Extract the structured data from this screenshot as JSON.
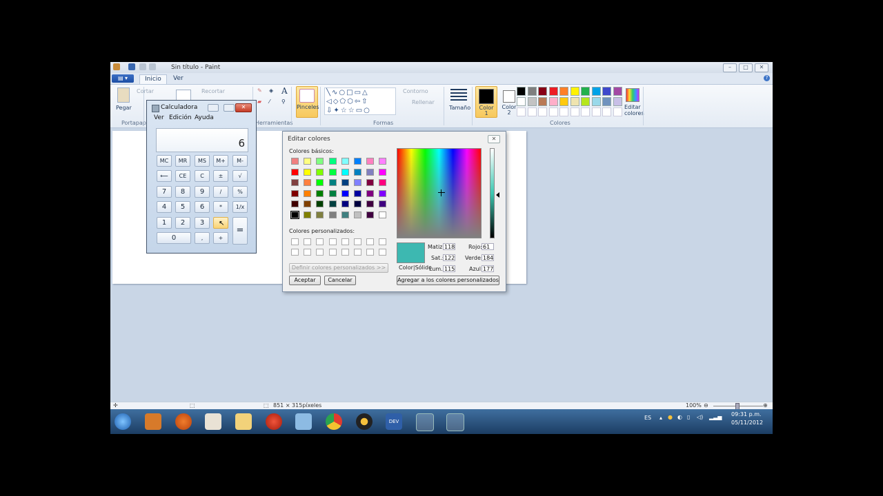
{
  "window": {
    "title": "Sin título - Paint",
    "min": "–",
    "max": "□",
    "close": "✕"
  },
  "tabs": [
    {
      "label": "Inicio"
    },
    {
      "label": "Ver"
    }
  ],
  "ribbon": {
    "paste": "Pegar",
    "cut": "Cortar",
    "crop": "Recortar",
    "clipboard_group": "Portapape",
    "tools_group": "Herramientas",
    "brushes": "Pinceles",
    "outline": "Contorno",
    "fill": "Rellenar",
    "shapes_group": "Formas",
    "size": "Tamaño",
    "color1": "Color\n1",
    "color2": "Color\n2",
    "edit_colors": "Editar\ncolores",
    "colors_group": "Colores"
  },
  "status": {
    "dimensions": "851 × 315píxeles",
    "zoom": "100%"
  },
  "taskbar": {
    "lang": "ES",
    "time": "09:31 p.m.",
    "date": "05/11/2012"
  },
  "calculator": {
    "title": "Calculadora",
    "menu": [
      "Ver",
      "Edición",
      "Ayuda"
    ],
    "display": "6",
    "keys": {
      "mc": "MC",
      "mr": "MR",
      "ms": "MS",
      "mplus": "M+",
      "mminus": "M-",
      "back": "⟵",
      "ce": "CE",
      "c": "C",
      "pm": "±",
      "sqrt": "√",
      "k7": "7",
      "k8": "8",
      "k9": "9",
      "div": "/",
      "pct": "%",
      "k4": "4",
      "k5": "5",
      "k6": "6",
      "mul": "*",
      "inv": "1/x",
      "k1": "1",
      "k2": "2",
      "k3": "3",
      "sub": "-",
      "eq": "=",
      "k0": "0",
      "dot": ",",
      "add": "+"
    }
  },
  "edit_colors": {
    "title": "Editar colores",
    "basic_label": "Colores básicos:",
    "custom_label": "Colores personalizados:",
    "define_button": "Definir colores personalizados >>",
    "ok": "Aceptar",
    "cancel": "Cancelar",
    "add_custom": "Agregar a los colores personalizados",
    "color_solid": "Color|Sólido",
    "hue_label": "Matiz:",
    "hue": "118",
    "sat_label": "Sat.:",
    "sat": "122",
    "lum_label": "Lum.:",
    "lum": "115",
    "red_label": "Rojo:",
    "red": "61",
    "green_label": "Verde:",
    "green": "184",
    "blue_label": "Azul:",
    "blue": "177",
    "preview_color": "#3db8b1",
    "basic_colors": [
      [
        "#f08080",
        "#ffff80",
        "#80ff80",
        "#00ff80",
        "#80ffff",
        "#0080ff",
        "#ff80c0",
        "#ff80ff"
      ],
      [
        "#ff0000",
        "#ffff00",
        "#80ff00",
        "#00ff40",
        "#00ffff",
        "#0080c0",
        "#8080c0",
        "#ff00ff"
      ],
      [
        "#804040",
        "#ff8040",
        "#00ff00",
        "#008080",
        "#004080",
        "#8080ff",
        "#800040",
        "#ff0080"
      ],
      [
        "#800000",
        "#ff8000",
        "#008000",
        "#008040",
        "#0000ff",
        "#0000a0",
        "#800080",
        "#8000ff"
      ],
      [
        "#400000",
        "#804000",
        "#004000",
        "#004040",
        "#000080",
        "#000040",
        "#400040",
        "#400080"
      ],
      [
        "#000000",
        "#808000",
        "#808040",
        "#808080",
        "#408080",
        "#c0c0c0",
        "#400040",
        "#ffffff"
      ]
    ]
  },
  "palette": [
    [
      "#000000",
      "#7f7f7f",
      "#880015",
      "#ed1c24",
      "#ff7f27",
      "#fff200",
      "#22b14c",
      "#00a2e8",
      "#3f48cc",
      "#a349a4"
    ],
    [
      "#ffffff",
      "#c3c3c3",
      "#b97a57",
      "#ffaec9",
      "#ffc90e",
      "#efe4b0",
      "#b5e61d",
      "#99d9ea",
      "#7092be",
      "#c8bfe7"
    ]
  ]
}
